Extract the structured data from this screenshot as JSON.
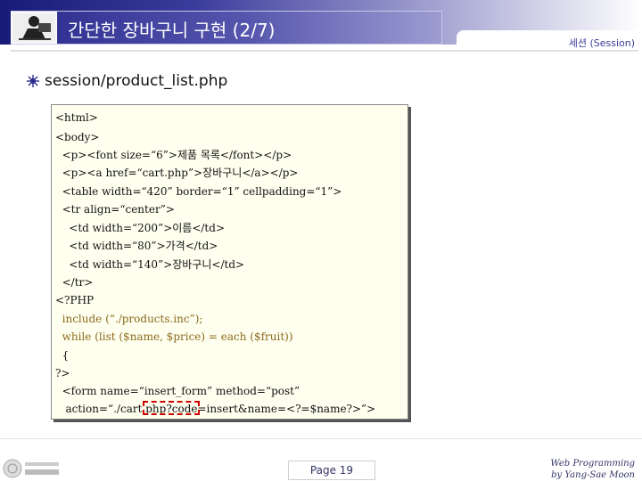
{
  "header": {
    "title": "간단한 장바구니 구현 (2/7)",
    "section": "세션 (Session)"
  },
  "subtitle": "session/product_list.php",
  "code_lines": [
    "<html>",
    "<body>",
    "  <p><font size=“6”>제품 목록</font></p>",
    "  <p><a href=“cart.php”>장바구니</a></p>",
    "  <table width=“420” border=“1” cellpadding=“1”>",
    "  <tr align=“center”>",
    "    <td width=“200”>이름</td>",
    "    <td width=“80”>가격</td>",
    "    <td width=“140”>장바구니</td>",
    "  </tr>",
    "<?PHP",
    "  include (“./products.inc”);",
    "  while (list ($name, $price) = each ($fruit))",
    "  {",
    "?>",
    "  <form name=“insert_form” method=“post”",
    "   action=“./cart.php?code=insert&name=<?=$name?>”>"
  ],
  "footer": {
    "page": "Page 19",
    "credit_line1": "Web Programming",
    "credit_line2": "by Yang-Sae Moon"
  },
  "colors": {
    "title_bar": "#3b3b9c",
    "highlight": "#d00000",
    "code_bg": "#fffff0"
  }
}
